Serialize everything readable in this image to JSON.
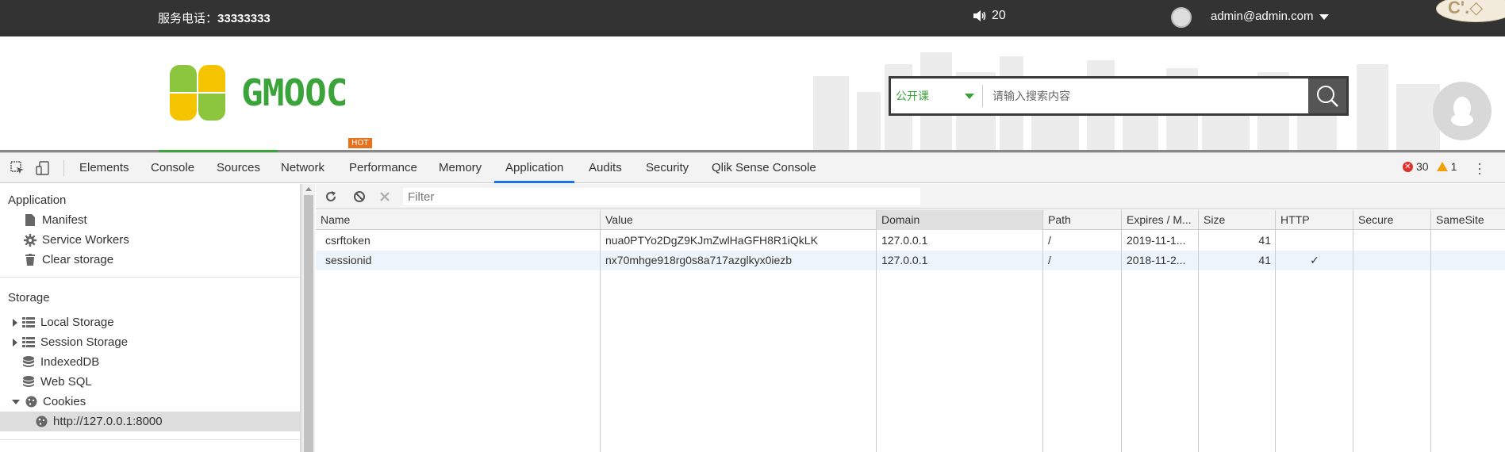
{
  "site": {
    "phone_label": "服务电话：",
    "phone_number": "33333333",
    "notice_count": "20",
    "user_email": "admin@admin.com",
    "floating_badge": "C'.◇",
    "logo_text": "GMOOC",
    "search_category": "公开课",
    "search_placeholder": "请输入搜索内容",
    "hot_badge": "HOT",
    "colors": {
      "topbar": "#333333",
      "brand_green": "#3aa33a",
      "logo_yellow": "#f5c400",
      "logo_lime": "#8cc63f",
      "hot": "#e8721c"
    }
  },
  "devtools": {
    "tabs": [
      {
        "label": "Elements"
      },
      {
        "label": "Console"
      },
      {
        "label": "Sources"
      },
      {
        "label": "Network"
      },
      {
        "label": "Performance"
      },
      {
        "label": "Memory"
      },
      {
        "label": "Application",
        "active": true
      },
      {
        "label": "Audits"
      },
      {
        "label": "Security"
      },
      {
        "label": "Qlik Sense Console"
      }
    ],
    "error_count": "30",
    "warning_count": "1",
    "sidebar": {
      "application_heading": "Application",
      "application_items": [
        {
          "label": "Manifest",
          "icon": "file-icon"
        },
        {
          "label": "Service Workers",
          "icon": "gear-icon"
        },
        {
          "label": "Clear storage",
          "icon": "trash-icon"
        }
      ],
      "storage_heading": "Storage",
      "storage_items": [
        {
          "label": "Local Storage",
          "icon": "grid-icon",
          "expander": "collapsed"
        },
        {
          "label": "Session Storage",
          "icon": "grid-icon",
          "expander": "collapsed"
        },
        {
          "label": "IndexedDB",
          "icon": "database-icon"
        },
        {
          "label": "Web SQL",
          "icon": "database-icon"
        },
        {
          "label": "Cookies",
          "icon": "cookie-icon",
          "expander": "expanded"
        },
        {
          "label": "http://127.0.0.1:8000",
          "icon": "cookie-icon",
          "selected": true
        }
      ]
    },
    "toolbar": {
      "filter_placeholder": "Filter"
    },
    "cookies": {
      "columns": [
        "Name",
        "Value",
        "Domain",
        "Path",
        "Expires / M...",
        "Size",
        "HTTP",
        "Secure",
        "SameSite"
      ],
      "rows": [
        {
          "name": "csrftoken",
          "value": "nua0PTYo2DgZ9KJmZwlHaGFH8R1iQkLK",
          "domain": "127.0.0.1",
          "path": "/",
          "expires": "2019-11-1...",
          "size": "41",
          "http": "",
          "secure": "",
          "samesite": ""
        },
        {
          "name": "sessionid",
          "value": "nx70mhge918rg0s8a717azglkyx0iezb",
          "domain": "127.0.0.1",
          "path": "/",
          "expires": "2018-11-2...",
          "size": "41",
          "http": "✓",
          "secure": "",
          "samesite": ""
        }
      ]
    }
  }
}
